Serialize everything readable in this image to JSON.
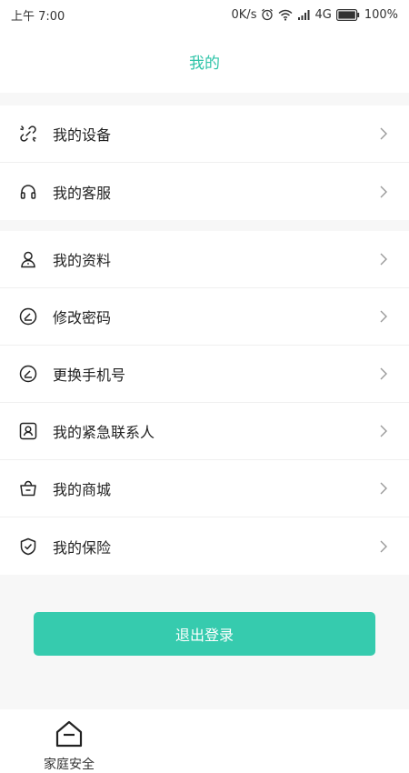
{
  "status_bar": {
    "time": "上午 7:00",
    "speed": "0K/s",
    "network": "4G",
    "battery": "100%"
  },
  "header": {
    "title": "我的"
  },
  "groups": [
    {
      "items": [
        {
          "label": "我的设备",
          "icon": "link-broken-icon"
        },
        {
          "label": "我的客服",
          "icon": "headset-icon"
        }
      ]
    },
    {
      "items": [
        {
          "label": "我的资料",
          "icon": "user-icon"
        },
        {
          "label": "修改密码",
          "icon": "edit-circle-icon"
        },
        {
          "label": "更换手机号",
          "icon": "edit-circle-icon"
        },
        {
          "label": "我的紧急联系人",
          "icon": "contact-card-icon"
        },
        {
          "label": "我的商城",
          "icon": "basket-icon"
        },
        {
          "label": "我的保险",
          "icon": "shield-check-icon"
        }
      ]
    }
  ],
  "logout_label": "退出登录",
  "tabbar": {
    "items": [
      {
        "label": "家庭安全",
        "icon": "home-icon"
      }
    ]
  },
  "colors": {
    "accent": "#2fc4a8",
    "button": "#36cbae"
  }
}
